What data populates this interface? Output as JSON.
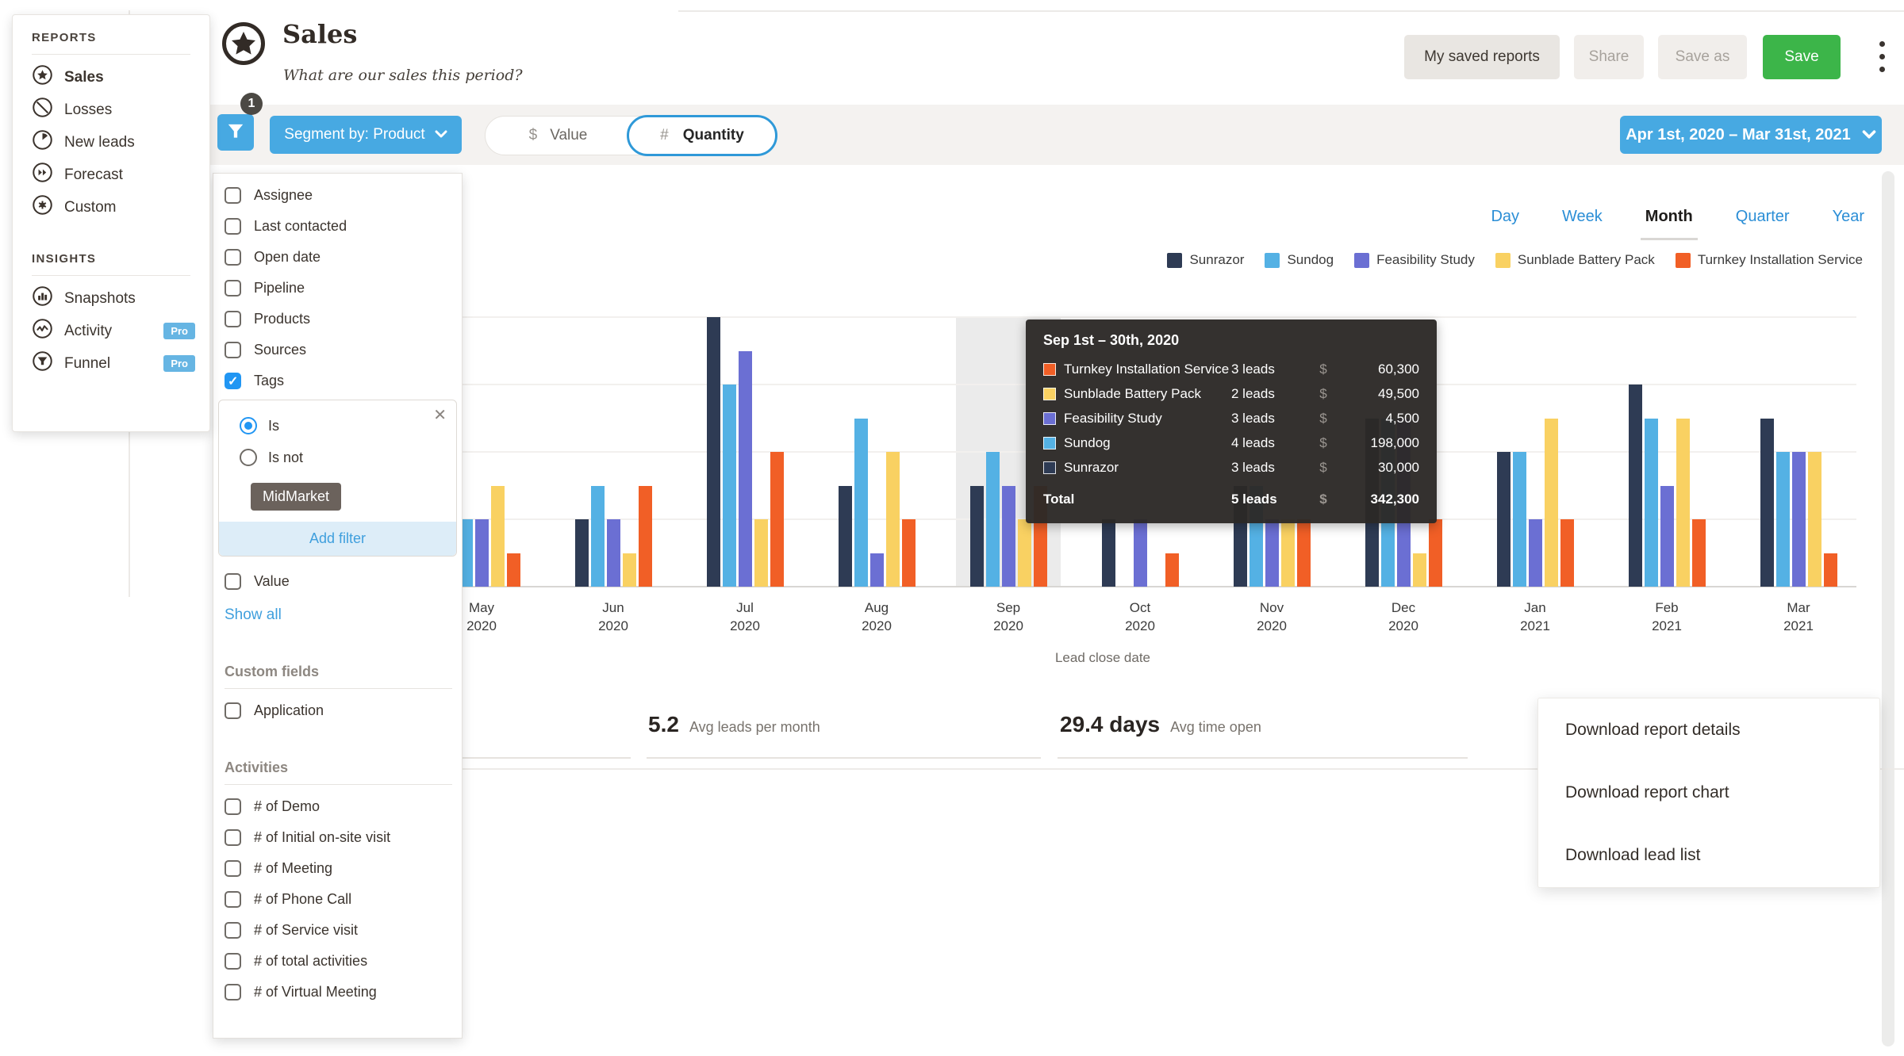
{
  "colors": {
    "accent_blue": "#47a9e2",
    "link_blue": "#2b8ed6",
    "save_green": "#3cb549",
    "check_blue": "#2196f3",
    "tooltip_bg": "#2c2926",
    "tag_chip": "#6b625c",
    "highlight_band": "#ebebeb"
  },
  "sidebar": {
    "reports_label": "REPORTS",
    "reports": [
      {
        "label": "Sales",
        "icon": "star-circle",
        "active": true
      },
      {
        "label": "Losses",
        "icon": "slash-circle"
      },
      {
        "label": "New leads",
        "icon": "pie-circle"
      },
      {
        "label": "Forecast",
        "icon": "forward-circle"
      },
      {
        "label": "Custom",
        "icon": "gear-circle"
      }
    ],
    "insights_label": "INSIGHTS",
    "insights": [
      {
        "label": "Snapshots",
        "icon": "chart-circle"
      },
      {
        "label": "Activity",
        "icon": "wave-circle",
        "badge": "Pro"
      },
      {
        "label": "Funnel",
        "icon": "funnel-circle",
        "badge": "Pro"
      }
    ]
  },
  "header": {
    "title": "Sales",
    "subtitle": "What are our sales this period?",
    "my_saved_reports": "My saved reports",
    "share": "Share",
    "save_as": "Save as",
    "save": "Save"
  },
  "toolbar": {
    "filter_badge": "1",
    "segment_label": "Segment by: Product",
    "value_symbol": "$",
    "value_label": "Value",
    "quantity_symbol": "#",
    "quantity_label": "Quantity",
    "active_toggle": "Quantity",
    "date_range": "Apr 1st, 2020 – Mar 31st, 2021"
  },
  "filter_panel": {
    "fields": [
      {
        "label": "Assignee"
      },
      {
        "label": "Last contacted"
      },
      {
        "label": "Open date"
      },
      {
        "label": "Pipeline"
      },
      {
        "label": "Products"
      },
      {
        "label": "Sources"
      },
      {
        "label": "Tags",
        "checked": true
      }
    ],
    "tag_editor": {
      "radios": [
        {
          "label": "Is",
          "selected": true
        },
        {
          "label": "Is not"
        }
      ],
      "tag": "MidMarket",
      "add_filter": "Add filter"
    },
    "value_field": "Value",
    "show_all": "Show all",
    "custom_fields_label": "Custom fields",
    "custom_fields": [
      {
        "label": "Application"
      }
    ],
    "activities_label": "Activities",
    "activities": [
      {
        "label": "# of Demo"
      },
      {
        "label": "# of Initial on-site visit"
      },
      {
        "label": "# of Meeting"
      },
      {
        "label": "# of Phone Call"
      },
      {
        "label": "# of Service visit"
      },
      {
        "label": "# of total activities"
      },
      {
        "label": "# of Virtual Meeting"
      }
    ]
  },
  "view_tabs": {
    "tabs": [
      "Day",
      "Week",
      "Month",
      "Quarter",
      "Year"
    ],
    "active": "Month"
  },
  "chart_data": {
    "type": "bar",
    "title": "Sales by lead close date, segmented by product (quantity of leads)",
    "xlabel": "Lead close date",
    "ylabel": "",
    "unit": "leads",
    "ylim": [
      0,
      8
    ],
    "gridline_step": 2,
    "grid": true,
    "legend_position": "top-right",
    "categories": [
      {
        "month": "May",
        "year": "2020"
      },
      {
        "month": "Jun",
        "year": "2020"
      },
      {
        "month": "Jul",
        "year": "2020"
      },
      {
        "month": "Aug",
        "year": "2020"
      },
      {
        "month": "Sep",
        "year": "2020"
      },
      {
        "month": "Oct",
        "year": "2020"
      },
      {
        "month": "Nov",
        "year": "2020"
      },
      {
        "month": "Dec",
        "year": "2020"
      },
      {
        "month": "Jan",
        "year": "2021"
      },
      {
        "month": "Feb",
        "year": "2021"
      },
      {
        "month": "Mar",
        "year": "2021"
      }
    ],
    "highlighted_category_index": 4,
    "series": [
      {
        "name": "Sunrazor",
        "color": "#2e3b54",
        "values": [
          2,
          2,
          8,
          3,
          3,
          2,
          3,
          5,
          4,
          6,
          5
        ]
      },
      {
        "name": "Sundog",
        "color": "#54b1e4",
        "values": [
          2,
          3,
          6,
          5,
          4,
          0,
          3,
          5,
          4,
          5,
          4
        ]
      },
      {
        "name": "Feasibility Study",
        "color": "#6b6fd3",
        "values": [
          2,
          2,
          7,
          1,
          3,
          2,
          2,
          5,
          2,
          3,
          4
        ]
      },
      {
        "name": "Sunblade Battery Pack",
        "color": "#f9d162",
        "values": [
          3,
          1,
          2,
          4,
          2,
          0,
          2,
          1,
          5,
          5,
          4
        ]
      },
      {
        "name": "Turnkey Installation Service",
        "color": "#f15f26",
        "values": [
          1,
          3,
          4,
          2,
          3,
          1,
          2,
          2,
          2,
          2,
          1
        ]
      }
    ]
  },
  "tooltip": {
    "title": "Sep 1st – 30th, 2020",
    "rows": [
      {
        "name": "Turnkey Installation Service",
        "color": "#f15f26",
        "leads": "3 leads",
        "currency": "$",
        "value": "60,300"
      },
      {
        "name": "Sunblade Battery Pack",
        "color": "#f9d162",
        "leads": "2 leads",
        "currency": "$",
        "value": "49,500"
      },
      {
        "name": "Feasibility Study",
        "color": "#6b6fd3",
        "leads": "3 leads",
        "currency": "$",
        "value": "4,500"
      },
      {
        "name": "Sundog",
        "color": "#54b1e4",
        "leads": "4 leads",
        "currency": "$",
        "value": "198,000"
      },
      {
        "name": "Sunrazor",
        "color": "#2e3b54",
        "leads": "3 leads",
        "currency": "$",
        "value": "30,000"
      }
    ],
    "total": {
      "name": "Total",
      "leads": "5 leads",
      "currency": "$",
      "value": "342,300"
    }
  },
  "stats": [
    {
      "value": "5.2",
      "label": "Avg leads per month"
    },
    {
      "value": "29.4 days",
      "label": "Avg time open"
    }
  ],
  "context_menu": {
    "items": [
      "Download report details",
      "Download report chart",
      "Download lead list"
    ]
  }
}
